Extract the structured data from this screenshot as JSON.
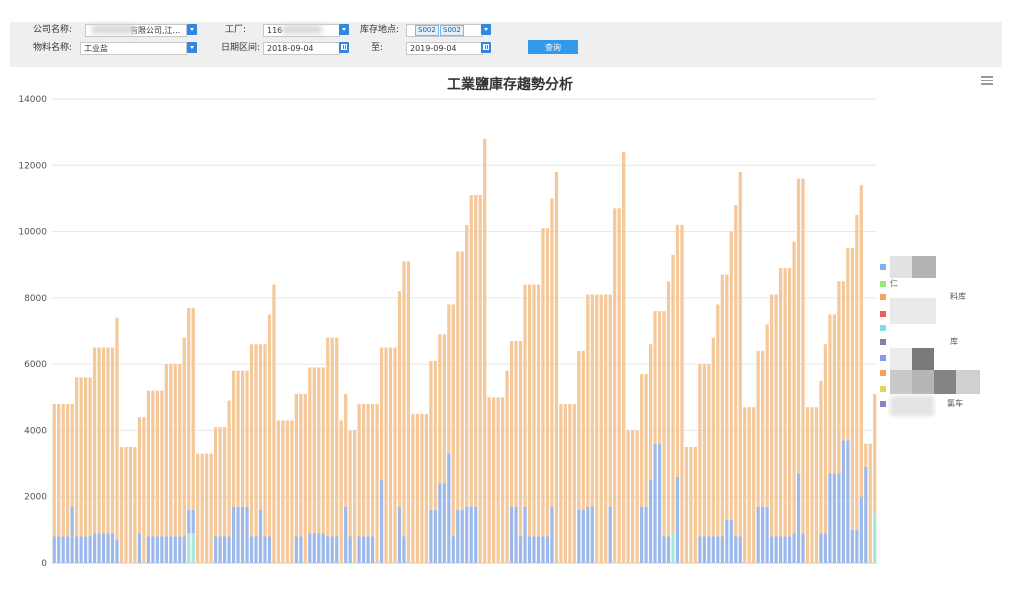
{
  "filters": {
    "company_label": "公司名称:",
    "company_value": "有限公司,江...",
    "plant_label": "工厂:",
    "plant_value": "116",
    "location_label": "库存地点:",
    "location_chips": [
      "S002",
      "S002"
    ],
    "material_label": "物料名称:",
    "material_value": "工业盐",
    "date_label": "日期区间:",
    "date_from": "2018-09-04",
    "to_label": "至:",
    "date_to": "2019-09-04",
    "query_button": "查询"
  },
  "colors": {
    "accent": "#2d8ae0",
    "series_orange": "#f5c89a",
    "series_blue": "#9db9ec",
    "series_cyan": "#a9e7dc",
    "grid": "#e6e6e6"
  },
  "chart_data": {
    "type": "bar",
    "stacked": true,
    "title": "工業鹽庫存趨勢分析",
    "xlabel": "",
    "ylabel": "",
    "ylim": [
      0,
      14000
    ],
    "yticks": [
      0,
      2000,
      4000,
      6000,
      8000,
      10000,
      12000,
      14000
    ],
    "grid": true,
    "legend_position": "right",
    "legend": [
      {
        "label": "",
        "color": "#7cb5ec"
      },
      {
        "label": "仁",
        "color": "#90ed7d"
      },
      {
        "label": "料库",
        "color": "#f7a35c"
      },
      {
        "label": "仁",
        "color": "#f45b5b"
      },
      {
        "label": "",
        "color": "#7de3d6"
      },
      {
        "label": "库",
        "color": "#8085a8"
      },
      {
        "label": "",
        "color": "#7f9be9"
      },
      {
        "label": "",
        "color": "#f0a35c"
      },
      {
        "label": "",
        "color": "#e4d354"
      },
      {
        "label": "氯车",
        "color": "#8e7fc9"
      }
    ],
    "bars": [
      [
        4800,
        800,
        0
      ],
      [
        4800,
        800,
        0
      ],
      [
        4800,
        800,
        0
      ],
      [
        4800,
        800,
        0
      ],
      [
        4800,
        1700,
        0
      ],
      [
        5600,
        800,
        0
      ],
      [
        5600,
        800,
        0
      ],
      [
        5600,
        800,
        0
      ],
      [
        5600,
        800,
        0
      ],
      [
        6500,
        900,
        0
      ],
      [
        6500,
        900,
        0
      ],
      [
        6500,
        900,
        0
      ],
      [
        6500,
        900,
        0
      ],
      [
        6500,
        900,
        0
      ],
      [
        7400,
        700,
        0
      ],
      [
        3500,
        0,
        0
      ],
      [
        3500,
        0,
        0
      ],
      [
        3500,
        0,
        0
      ],
      [
        3500,
        0,
        0
      ],
      [
        4400,
        900,
        0
      ],
      [
        4400,
        0,
        0
      ],
      [
        5200,
        800,
        0
      ],
      [
        5200,
        800,
        0
      ],
      [
        5200,
        800,
        0
      ],
      [
        5200,
        800,
        0
      ],
      [
        6000,
        800,
        0
      ],
      [
        6000,
        800,
        0
      ],
      [
        6000,
        800,
        0
      ],
      [
        6000,
        800,
        0
      ],
      [
        6800,
        800,
        0
      ],
      [
        7700,
        1600,
        900
      ],
      [
        7700,
        1600,
        900
      ],
      [
        3300,
        0,
        0
      ],
      [
        3300,
        0,
        0
      ],
      [
        3300,
        0,
        0
      ],
      [
        3300,
        0,
        0
      ],
      [
        4100,
        800,
        0
      ],
      [
        4100,
        800,
        0
      ],
      [
        4100,
        800,
        0
      ],
      [
        4900,
        800,
        0
      ],
      [
        5800,
        1700,
        0
      ],
      [
        5800,
        1700,
        0
      ],
      [
        5800,
        1700,
        0
      ],
      [
        5800,
        1700,
        0
      ],
      [
        6600,
        800,
        0
      ],
      [
        6600,
        800,
        0
      ],
      [
        6600,
        1600,
        0
      ],
      [
        6600,
        800,
        0
      ],
      [
        7500,
        800,
        0
      ],
      [
        8400,
        0,
        0
      ],
      [
        4300,
        0,
        0
      ],
      [
        4300,
        0,
        0
      ],
      [
        4300,
        0,
        0
      ],
      [
        4300,
        0,
        0
      ],
      [
        5100,
        800,
        0
      ],
      [
        5100,
        800,
        0
      ],
      [
        5100,
        0,
        0
      ],
      [
        5900,
        900,
        0
      ],
      [
        5900,
        900,
        0
      ],
      [
        5900,
        900,
        0
      ],
      [
        5900,
        900,
        0
      ],
      [
        6800,
        800,
        0
      ],
      [
        6800,
        800,
        0
      ],
      [
        6800,
        800,
        0
      ],
      [
        4300,
        0,
        0
      ],
      [
        5100,
        1700,
        0
      ],
      [
        4000,
        800,
        0
      ],
      [
        4000,
        0,
        0
      ],
      [
        4800,
        800,
        0
      ],
      [
        4800,
        800,
        0
      ],
      [
        4800,
        800,
        0
      ],
      [
        4800,
        800,
        0
      ],
      [
        4800,
        0,
        0
      ],
      [
        6500,
        2500,
        0
      ],
      [
        6500,
        0,
        0
      ],
      [
        6500,
        0,
        0
      ],
      [
        6500,
        0,
        0
      ],
      [
        8200,
        1700,
        0
      ],
      [
        9100,
        800,
        0
      ],
      [
        9100,
        0,
        0
      ],
      [
        4500,
        0,
        0
      ],
      [
        4500,
        0,
        0
      ],
      [
        4500,
        0,
        0
      ],
      [
        4500,
        0,
        0
      ],
      [
        6100,
        1600,
        0
      ],
      [
        6100,
        1600,
        0
      ],
      [
        6900,
        2400,
        0
      ],
      [
        6900,
        2400,
        0
      ],
      [
        7800,
        3300,
        0
      ],
      [
        7800,
        800,
        0
      ],
      [
        9400,
        1600,
        0
      ],
      [
        9400,
        1600,
        0
      ],
      [
        10200,
        1700,
        0
      ],
      [
        11100,
        1700,
        0
      ],
      [
        11100,
        1700,
        0
      ],
      [
        11100,
        0,
        0
      ],
      [
        12800,
        0,
        0
      ],
      [
        5000,
        0,
        0
      ],
      [
        5000,
        0,
        0
      ],
      [
        5000,
        0,
        0
      ],
      [
        5000,
        0,
        0
      ],
      [
        5800,
        0,
        0
      ],
      [
        6700,
        1700,
        0
      ],
      [
        6700,
        1700,
        0
      ],
      [
        6700,
        800,
        0
      ],
      [
        8400,
        1700,
        0
      ],
      [
        8400,
        800,
        0
      ],
      [
        8400,
        800,
        0
      ],
      [
        8400,
        800,
        0
      ],
      [
        10100,
        800,
        0
      ],
      [
        10100,
        800,
        0
      ],
      [
        11000,
        1700,
        0
      ],
      [
        11800,
        0,
        0
      ],
      [
        4800,
        0,
        0
      ],
      [
        4800,
        0,
        0
      ],
      [
        4800,
        0,
        0
      ],
      [
        4800,
        0,
        0
      ],
      [
        6400,
        1600,
        0
      ],
      [
        6400,
        1600,
        0
      ],
      [
        8100,
        1700,
        0
      ],
      [
        8100,
        1700,
        0
      ],
      [
        8100,
        0,
        0
      ],
      [
        8100,
        0,
        0
      ],
      [
        8100,
        0,
        0
      ],
      [
        8100,
        1700,
        0
      ],
      [
        10700,
        0,
        0
      ],
      [
        10700,
        0,
        0
      ],
      [
        12400,
        0,
        0
      ],
      [
        4000,
        0,
        0
      ],
      [
        4000,
        0,
        0
      ],
      [
        4000,
        0,
        0
      ],
      [
        5700,
        1700,
        0
      ],
      [
        5700,
        1700,
        0
      ],
      [
        6600,
        2500,
        0
      ],
      [
        7600,
        3600,
        0
      ],
      [
        7600,
        3600,
        0
      ],
      [
        7600,
        800,
        0
      ],
      [
        8500,
        800,
        0
      ],
      [
        9300,
        900,
        900
      ],
      [
        10200,
        2600,
        0
      ],
      [
        10200,
        0,
        0
      ],
      [
        3500,
        0,
        0
      ],
      [
        3500,
        0,
        0
      ],
      [
        3500,
        0,
        0
      ],
      [
        6000,
        800,
        0
      ],
      [
        6000,
        800,
        0
      ],
      [
        6000,
        800,
        0
      ],
      [
        6800,
        800,
        0
      ],
      [
        7800,
        800,
        0
      ],
      [
        8700,
        800,
        0
      ],
      [
        8700,
        1300,
        0
      ],
      [
        10000,
        1300,
        0
      ],
      [
        10800,
        800,
        0
      ],
      [
        11800,
        800,
        0
      ],
      [
        4700,
        0,
        0
      ],
      [
        4700,
        0,
        0
      ],
      [
        4700,
        0,
        0
      ],
      [
        6400,
        1700,
        0
      ],
      [
        6400,
        1700,
        0
      ],
      [
        7200,
        1700,
        0
      ],
      [
        8100,
        800,
        0
      ],
      [
        8100,
        800,
        0
      ],
      [
        8900,
        800,
        0
      ],
      [
        8900,
        800,
        0
      ],
      [
        8900,
        800,
        0
      ],
      [
        9700,
        900,
        0
      ],
      [
        11600,
        2700,
        0
      ],
      [
        11600,
        900,
        0
      ],
      [
        4700,
        0,
        0
      ],
      [
        4700,
        0,
        0
      ],
      [
        4700,
        0,
        0
      ],
      [
        5500,
        900,
        0
      ],
      [
        6600,
        900,
        0
      ],
      [
        7500,
        2700,
        0
      ],
      [
        7500,
        2700,
        0
      ],
      [
        8500,
        2700,
        0
      ],
      [
        8500,
        3700,
        0
      ],
      [
        9500,
        3700,
        0
      ],
      [
        9500,
        1000,
        0
      ],
      [
        10500,
        1000,
        0
      ],
      [
        11400,
        2000,
        0
      ],
      [
        3600,
        2900,
        0
      ],
      [
        3600,
        0,
        0
      ],
      [
        5100,
        0,
        1500
      ]
    ]
  }
}
